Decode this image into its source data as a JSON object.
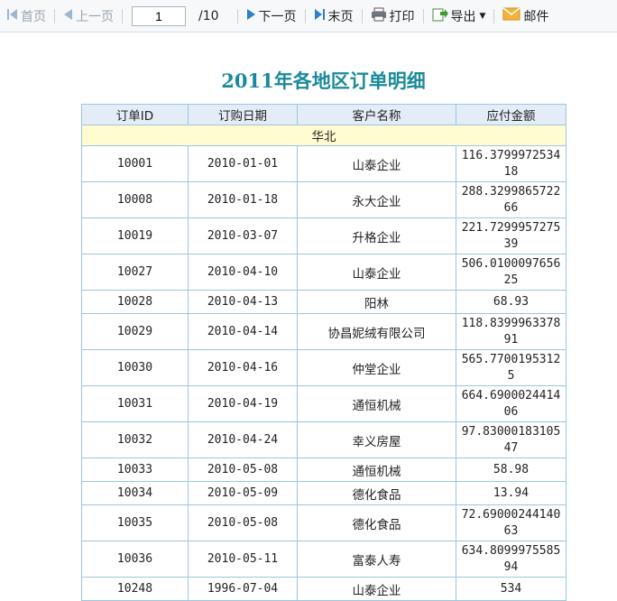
{
  "toolbar": {
    "first_label": "首页",
    "prev_label": "上一页",
    "page_current": "1",
    "page_total": "/10",
    "next_label": "下一页",
    "last_label": "末页",
    "print_label": "打印",
    "export_label": "导出",
    "mail_label": "邮件"
  },
  "report": {
    "title": "2011年各地区订单明细",
    "headers": [
      "订单ID",
      "订购日期",
      "客户名称",
      "应付金额"
    ],
    "group": "华北",
    "rows": [
      {
        "id": "10001",
        "date": "2010-01-01",
        "customer": "山泰企业",
        "amount": "116.379997253418"
      },
      {
        "id": "10008",
        "date": "2010-01-18",
        "customer": "永大企业",
        "amount": "288.329986572266"
      },
      {
        "id": "10019",
        "date": "2010-03-07",
        "customer": "升格企业",
        "amount": "221.729995727539"
      },
      {
        "id": "10027",
        "date": "2010-04-10",
        "customer": "山泰企业",
        "amount": "506.010009765625"
      },
      {
        "id": "10028",
        "date": "2010-04-13",
        "customer": "阳林",
        "amount": "68.93"
      },
      {
        "id": "10029",
        "date": "2010-04-14",
        "customer": "协昌妮绒有限公司",
        "amount": "118.839996337891"
      },
      {
        "id": "10030",
        "date": "2010-04-16",
        "customer": "仲堂企业",
        "amount": "565.7700195312 5"
      },
      {
        "id": "10031",
        "date": "2010-04-19",
        "customer": "通恒机械",
        "amount": "664.690002441406"
      },
      {
        "id": "10032",
        "date": "2010-04-24",
        "customer": "幸义房屋",
        "amount": "97.8300018310547"
      },
      {
        "id": "10033",
        "date": "2010-05-08",
        "customer": "通恒机械",
        "amount": "58.98"
      },
      {
        "id": "10034",
        "date": "2010-05-09",
        "customer": "德化食品",
        "amount": "13.94"
      },
      {
        "id": "10035",
        "date": "2010-05-08",
        "customer": "德化食品",
        "amount": "72.6900024414063"
      },
      {
        "id": "10036",
        "date": "2010-05-11",
        "customer": "富泰人寿",
        "amount": "634.809997558594"
      },
      {
        "id": "10248",
        "date": "1996-07-04",
        "customer": "山泰企业",
        "amount": "534"
      }
    ]
  },
  "colors": {
    "title": "#1a8a9a",
    "header_bg": "#e4ecf8",
    "group_bg": "#fffdd0",
    "border": "#9cc6de"
  }
}
